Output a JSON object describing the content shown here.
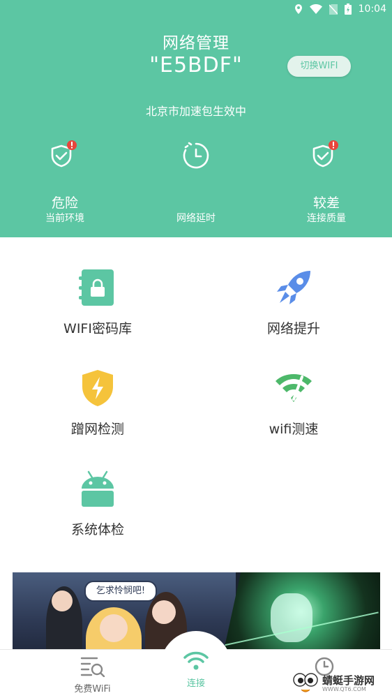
{
  "status_bar": {
    "time": "10:04"
  },
  "header": {
    "title": "网络管理",
    "ssid": "\"E5BDF\"",
    "switch_button": "切换WIFI",
    "acceleration_status": "北京市加速包生效中",
    "stats": [
      {
        "value": "危险",
        "label": "当前环境",
        "icon": "shield-alert-icon"
      },
      {
        "value": "",
        "label": "网络延时",
        "icon": "timer-icon"
      },
      {
        "value": "较差",
        "label": "连接质量",
        "icon": "shield-alert-icon"
      }
    ]
  },
  "tools": [
    {
      "label": "WIFI密码库",
      "icon": "lock-book-icon"
    },
    {
      "label": "网络提升",
      "icon": "rocket-icon"
    },
    {
      "label": "蹭网检测",
      "icon": "shield-bolt-icon"
    },
    {
      "label": "wifi测速",
      "icon": "wifi-speed-icon"
    },
    {
      "label": "系统体检",
      "icon": "android-icon"
    }
  ],
  "banner": {
    "bubble_text": "乞求怜悯吧!"
  },
  "bottom_nav": {
    "items": [
      {
        "label": "免费WiFi",
        "icon": "search-list-icon"
      },
      {
        "label": "连接",
        "icon": "wifi-icon",
        "active": true
      },
      {
        "label": "",
        "icon": "clock-icon"
      }
    ]
  },
  "watermark": {
    "text": "蜻蜓手游网",
    "sub": "WWW.QT6.COM"
  },
  "colors": {
    "primary": "#5cc6a3",
    "alert": "#e8453c",
    "rocket": "#5a8de8",
    "shield": "#f5c33b",
    "android": "#5cc6a3"
  }
}
